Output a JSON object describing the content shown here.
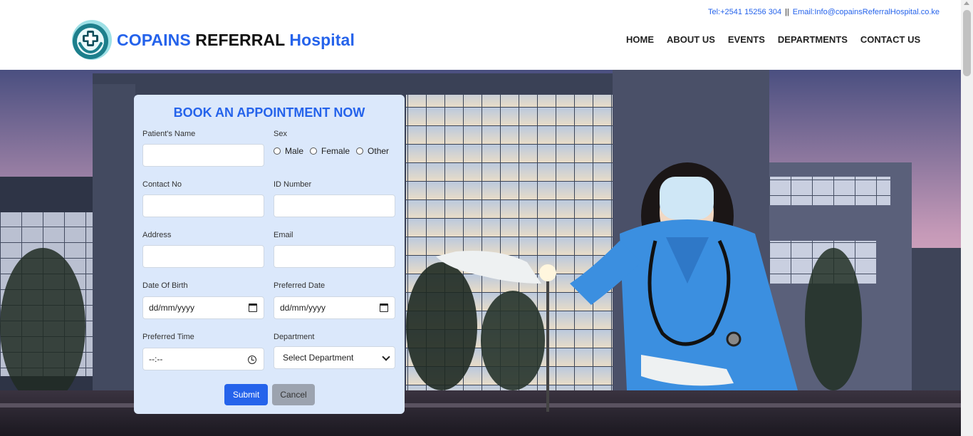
{
  "header": {
    "phone": "Tel:+2541 15256 304",
    "separator": "||",
    "email": "Email:Info@copainsReferralHospital.co.ke",
    "brand": {
      "part1": "COPAINS",
      "part2": "REFERRAL",
      "part3": "Hospital"
    },
    "nav": [
      "HOME",
      "ABOUT US",
      "EVENTS",
      "DEPARTMENTS",
      "CONTACT US"
    ]
  },
  "form": {
    "title": "BOOK AN APPOINTMENT NOW",
    "patient_name_label": "Patient's Name",
    "sex_label": "Sex",
    "sex_options": [
      "Male",
      "Female",
      "Other"
    ],
    "contact_label": "Contact No",
    "id_label": "ID Number",
    "address_label": "Address",
    "email_label": "Email",
    "dob_label": "Date Of Birth",
    "dob_value": "dd/mm/yyyy",
    "pref_date_label": "Preferred Date",
    "pref_date_value": "dd/mm/yyyy",
    "pref_time_label": "Preferred Time",
    "pref_time_value": "--:--",
    "department_label": "Department",
    "department_value": "Select Department",
    "submit_label": "Submit",
    "cancel_label": "Cancel"
  },
  "colors": {
    "accent": "#2563eb",
    "form_bg": "#dbe8fb",
    "cancel_bg": "#9ca3af",
    "scrubs": "#3b8fe0"
  }
}
